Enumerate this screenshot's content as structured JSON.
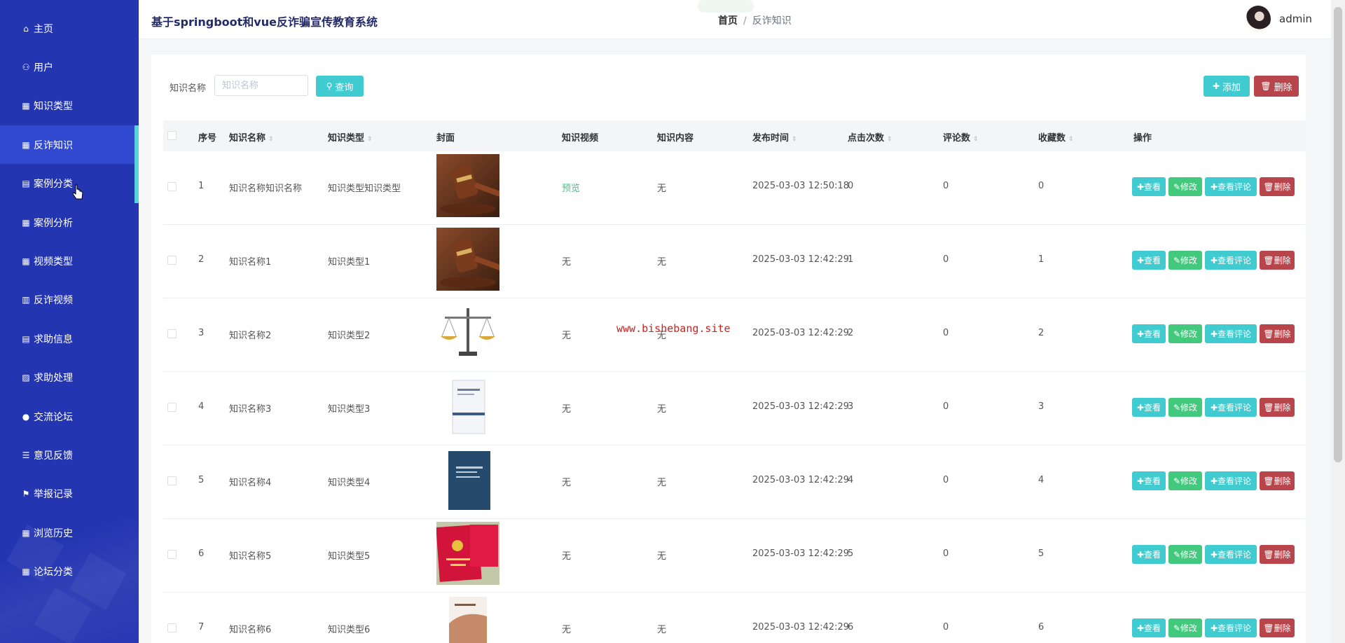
{
  "header": {
    "site_title": "基于springboot和vue反诈骗宣传教育系统",
    "breadcrumb_home": "首页",
    "breadcrumb_separator": "/",
    "breadcrumb_current": "反诈知识",
    "username": "admin"
  },
  "sidebar": {
    "items": [
      {
        "label": "主页",
        "icon": "home-icon",
        "glyph": "⌂"
      },
      {
        "label": "用户",
        "icon": "user-icon",
        "glyph": "⚇"
      },
      {
        "label": "知识类型",
        "icon": "grid-icon",
        "glyph": "▦"
      },
      {
        "label": "反诈知识",
        "icon": "grid-icon",
        "glyph": "▦",
        "active": true
      },
      {
        "label": "案例分类",
        "icon": "clipboard-icon",
        "glyph": "▤"
      },
      {
        "label": "案例分析",
        "icon": "grid-icon",
        "glyph": "▦"
      },
      {
        "label": "视频类型",
        "icon": "grid-icon",
        "glyph": "▦"
      },
      {
        "label": "反诈视频",
        "icon": "video-icon",
        "glyph": "▥"
      },
      {
        "label": "求助信息",
        "icon": "clipboard-icon",
        "glyph": "▤"
      },
      {
        "label": "求助处理",
        "icon": "chart-icon",
        "glyph": "▨"
      },
      {
        "label": "交流论坛",
        "icon": "bulb-icon",
        "glyph": "●"
      },
      {
        "label": "意见反馈",
        "icon": "list-icon",
        "glyph": "☰"
      },
      {
        "label": "举报记录",
        "icon": "flag-icon",
        "glyph": "⚑"
      },
      {
        "label": "浏览历史",
        "icon": "grid-icon",
        "glyph": "▦"
      },
      {
        "label": "论坛分类",
        "icon": "grid-icon",
        "glyph": "▦"
      }
    ]
  },
  "search": {
    "label": "知识名称",
    "placeholder": "知识名称",
    "query_label": "查询"
  },
  "toolbar": {
    "add_label": "添加",
    "delete_label": "删除"
  },
  "table": {
    "columns": {
      "index": "序号",
      "name": "知识名称",
      "type": "知识类型",
      "cover": "封面",
      "video": "知识视频",
      "content": "知识内容",
      "time": "发布时间",
      "clicks": "点击次数",
      "comments": "评论数",
      "favorites": "收藏数",
      "ops": "操作"
    },
    "op_labels": {
      "view": "查看",
      "edit": "修改",
      "comment": "查看评论",
      "delete": "删除"
    },
    "rows": [
      {
        "index": "1",
        "name": "知识名称知识名称",
        "type": "知识类型知识类型",
        "cover": "gavel",
        "video": "预览",
        "content": "无",
        "time": "2025-03-03 12:50:18",
        "clicks": "0",
        "comments": "0",
        "favorites": "0"
      },
      {
        "index": "2",
        "name": "知识名称1",
        "type": "知识类型1",
        "cover": "gavel",
        "video": "无",
        "content": "无",
        "time": "2025-03-03 12:42:29",
        "clicks": "1",
        "comments": "0",
        "favorites": "1"
      },
      {
        "index": "3",
        "name": "知识名称2",
        "type": "知识类型2",
        "cover": "scales",
        "video": "无",
        "content": "无",
        "time": "2025-03-03 12:42:29",
        "clicks": "2",
        "comments": "0",
        "favorites": "2"
      },
      {
        "index": "4",
        "name": "知识名称3",
        "type": "知识类型3",
        "cover": "white-book",
        "video": "无",
        "content": "无",
        "time": "2025-03-03 12:42:29",
        "clicks": "3",
        "comments": "0",
        "favorites": "3"
      },
      {
        "index": "5",
        "name": "知识名称4",
        "type": "知识类型4",
        "cover": "blue-book",
        "video": "无",
        "content": "无",
        "time": "2025-03-03 12:42:29",
        "clicks": "4",
        "comments": "0",
        "favorites": "4"
      },
      {
        "index": "6",
        "name": "知识名称5",
        "type": "知识类型5",
        "cover": "red-book",
        "video": "无",
        "content": "无",
        "time": "2025-03-03 12:42:29",
        "clicks": "5",
        "comments": "0",
        "favorites": "5"
      },
      {
        "index": "7",
        "name": "知识名称6",
        "type": "知识类型6",
        "cover": "brown-book",
        "video": "无",
        "content": "无",
        "time": "2025-03-03 12:42:29",
        "clicks": "6",
        "comments": "0",
        "favorites": "6"
      }
    ]
  },
  "watermark": "www.bishebang.site",
  "colors": {
    "sidebar_bg": "#2435b2",
    "sidebar_active": "#3049d0",
    "accent_cyan": "#40cbd0",
    "edit_green": "#43c97d",
    "danger_red": "#b8454b"
  }
}
